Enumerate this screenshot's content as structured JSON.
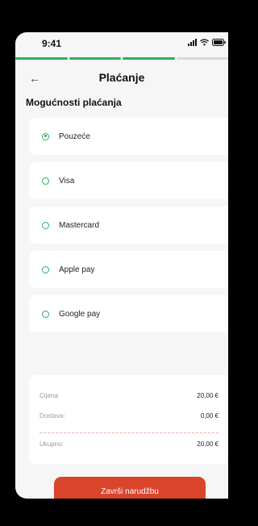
{
  "status_bar": {
    "time": "9:41"
  },
  "progress": {
    "steps_total": 4,
    "steps_completed": 3
  },
  "header": {
    "title": "Plaćanje",
    "back_icon": "arrow-left-icon"
  },
  "section_title": "Mogućnosti plaćanja",
  "payment_options": [
    {
      "label": "Pouzeće",
      "selected": true
    },
    {
      "label": "Visa",
      "selected": false
    },
    {
      "label": "Mastercard",
      "selected": false
    },
    {
      "label": "Apple pay",
      "selected": false
    },
    {
      "label": "Google pay",
      "selected": false
    }
  ],
  "summary": {
    "price_label": "Cijena:",
    "price_value": "20,00 €",
    "shipping_label": "Dostava:",
    "shipping_value": "0,00 €",
    "total_label": "Ukupno:",
    "total_value": "20,00 €"
  },
  "cta": {
    "label": "Završi narudžbu"
  },
  "colors": {
    "accent_green": "#2fae5a",
    "cta_red": "#d9442b",
    "background": "#f6f6f6"
  }
}
